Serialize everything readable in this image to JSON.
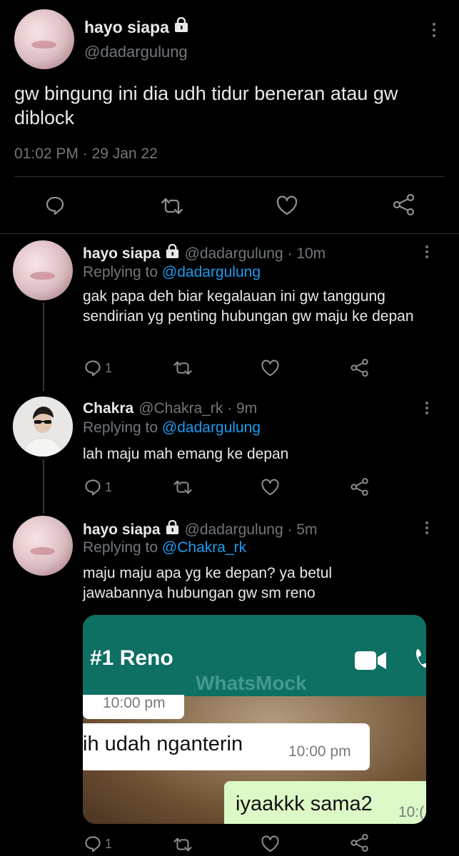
{
  "main_tweet": {
    "display_name": "hayo siapa",
    "handle": "@dadargulung",
    "text": "gw bingung ini dia udh tidur beneran atau gw diblock",
    "meta": "01:02 PM · 29 Jan 22"
  },
  "replies": [
    {
      "display_name": "hayo siapa",
      "handle_time": "@dadargulung · 10m",
      "replying_prefix": "Replying to",
      "replying_to": "@dadargulung",
      "text": "gak papa deh biar kegalauan ini gw tanggung sendirian yg penting hubungan gw maju ke depan",
      "reply_count": "1"
    },
    {
      "display_name": "Chakra",
      "handle_time": "@Chakra_rk · 9m",
      "replying_prefix": "Replying to",
      "replying_to": "@dadargulung",
      "text": "lah maju mah emang ke depan",
      "reply_count": "1"
    },
    {
      "display_name": "hayo siapa",
      "handle_time": "@dadargulung · 5m",
      "replying_prefix": "Replying to",
      "replying_to": "@Chakra_rk",
      "text": "maju maju apa yg ke depan? ya betul jawabannya hubungan gw sm reno",
      "reply_count": "1"
    }
  ],
  "whatsapp": {
    "chat_title": "#1 Reno",
    "watermark": "WhatsMock",
    "messages": [
      {
        "text": "",
        "time": "10:00 pm"
      },
      {
        "text": "ih udah nganterin",
        "time": "10:00 pm"
      },
      {
        "text": "iyaakkk sama2",
        "time": "10:("
      }
    ]
  },
  "colors": {
    "background": "#000000",
    "text": "#e7e9ea",
    "muted": "#71767b",
    "link": "#1d9bf0",
    "divider": "#2f3336",
    "whatsapp_header": "#0e6f63"
  },
  "icons": [
    "lock-icon",
    "more-icon",
    "reply-icon",
    "retweet-icon",
    "like-icon",
    "share-icon",
    "video-call-icon",
    "phone-icon"
  ]
}
